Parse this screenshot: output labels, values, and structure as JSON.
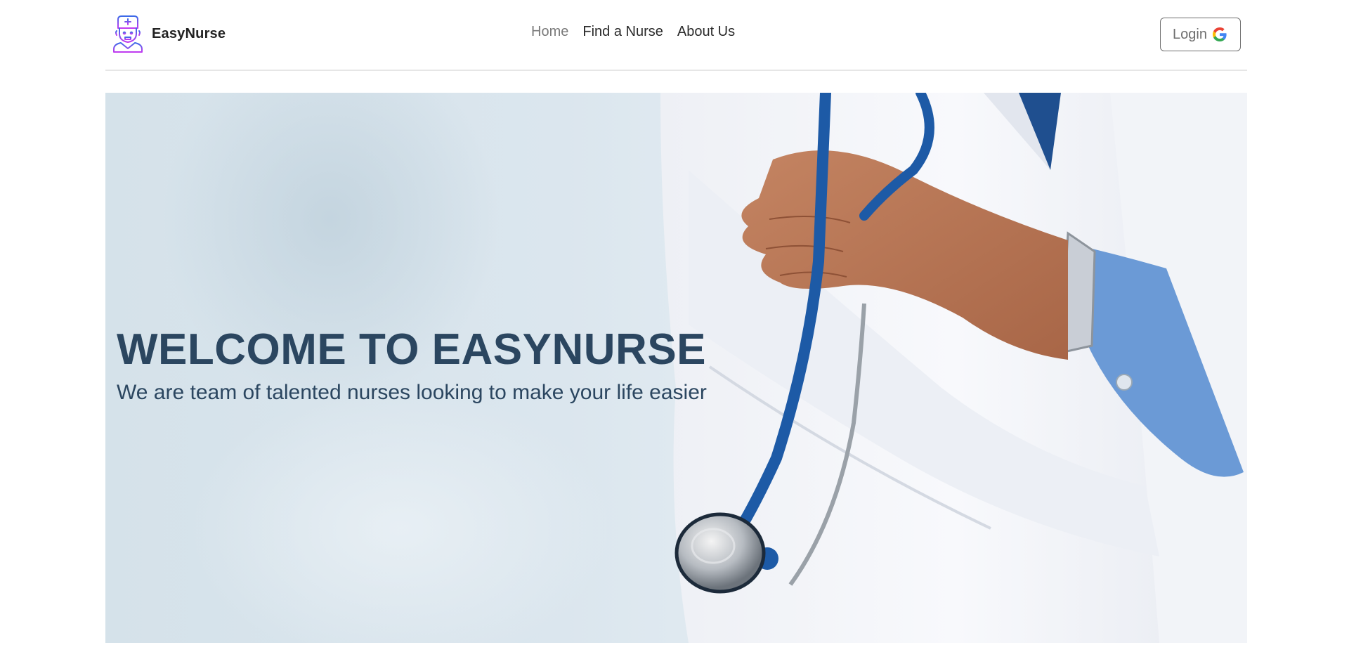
{
  "brand": {
    "name": "EasyNurse",
    "logo_icon": "nurse-icon"
  },
  "nav": {
    "links": [
      {
        "label": "Home",
        "active": true
      },
      {
        "label": "Find a Nurse",
        "active": false
      },
      {
        "label": "About Us",
        "active": false
      }
    ]
  },
  "login": {
    "label": "Login",
    "icon": "google-icon"
  },
  "hero": {
    "title": "WELCOME TO EASYNURSE",
    "subtitle": "We are team of talented nurses looking to make your life easier",
    "image": "doctor-with-stethoscope-photo"
  },
  "colors": {
    "text_primary": "#2b4660",
    "nav_active": "#7a7a7a",
    "logo_gradient_start": "#3b6be8",
    "logo_gradient_end": "#c23bf0"
  }
}
